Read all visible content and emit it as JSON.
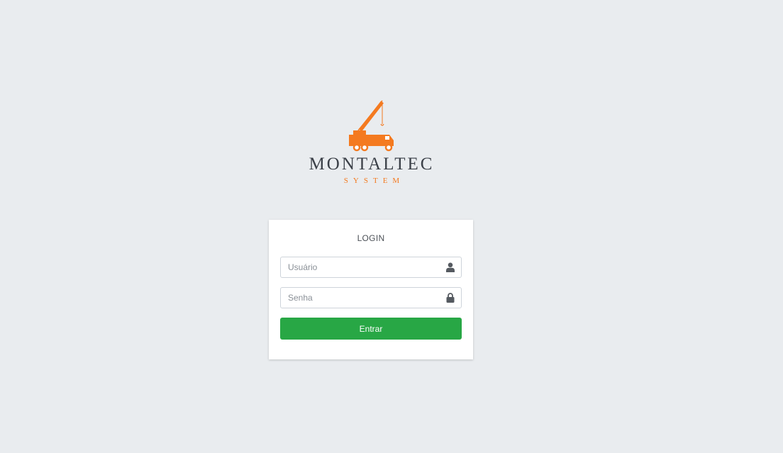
{
  "brand": {
    "name": "MONTALTEC",
    "subtitle": "SYSTEM",
    "logo_icon": "crane-truck-icon",
    "accent_color": "#f47a20",
    "name_color": "#3b4048"
  },
  "login": {
    "title": "LOGIN",
    "username": {
      "placeholder": "Usuário",
      "value": "",
      "icon": "user-icon"
    },
    "password": {
      "placeholder": "Senha",
      "value": "",
      "icon": "lock-icon"
    },
    "submit_label": "Entrar",
    "submit_color": "#28a745"
  }
}
